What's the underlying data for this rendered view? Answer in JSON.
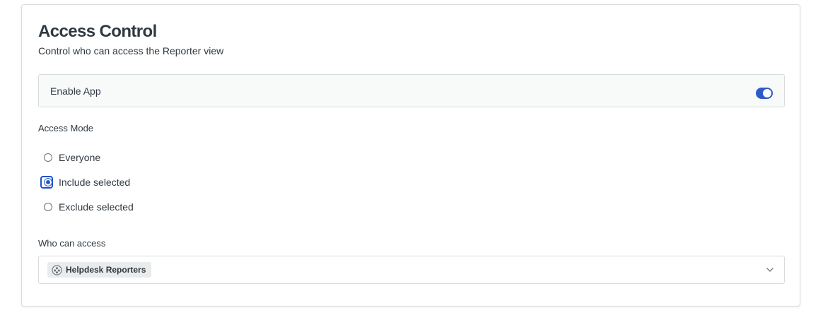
{
  "access_control": {
    "title": "Access Control",
    "subtitle": "Control who can access the Reporter view"
  },
  "enable_app": {
    "label": "Enable App",
    "enabled": true,
    "accent_color": "#2d5cc7"
  },
  "access_mode": {
    "label": "Access Mode",
    "options": [
      {
        "label": "Everyone",
        "checked": false
      },
      {
        "label": "Include selected",
        "checked": true
      },
      {
        "label": "Exclude selected",
        "checked": false
      }
    ]
  },
  "who_can_access": {
    "label": "Who can access",
    "selected_tags": [
      {
        "label": "Helpdesk Reporters",
        "icon": "group-icon"
      }
    ],
    "dropdown_icon": "chevron-down-icon"
  }
}
